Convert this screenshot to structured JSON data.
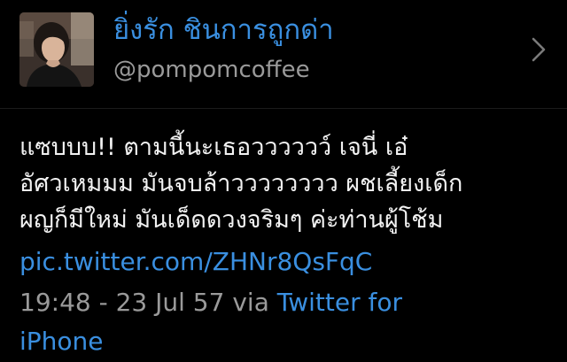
{
  "profile": {
    "display_name": "ยิ่งรัก ชินการถูกด่า",
    "handle": "@pompomcoffee",
    "avatar_icon": "user-photo-avatar",
    "chevron_icon": "chevron-right-icon"
  },
  "tweet": {
    "lines": [
      "แซบบบ!! ตามนี้นะเธอวววววว์ เจนี่ เอ๋",
      "อัศวเหมมม มันจบล้าวววววววว ผชเลี้ยงเด็ก",
      "ผญก็มีใหม่ มันเด็ดดวงจริมๆ ค่ะท่านผู้โช้ม"
    ],
    "link": "pic.twitter.com/ZHNr8QsFqC",
    "timestamp": "19:48 - 23 Jul 57",
    "via_label": "via",
    "via_app_line1": "Twitter for",
    "via_app_line2": "iPhone"
  },
  "colors": {
    "background": "#000000",
    "link_blue": "#3a8fe0",
    "secondary_gray": "#9a9a9a",
    "text_white": "#f2f2f2"
  }
}
